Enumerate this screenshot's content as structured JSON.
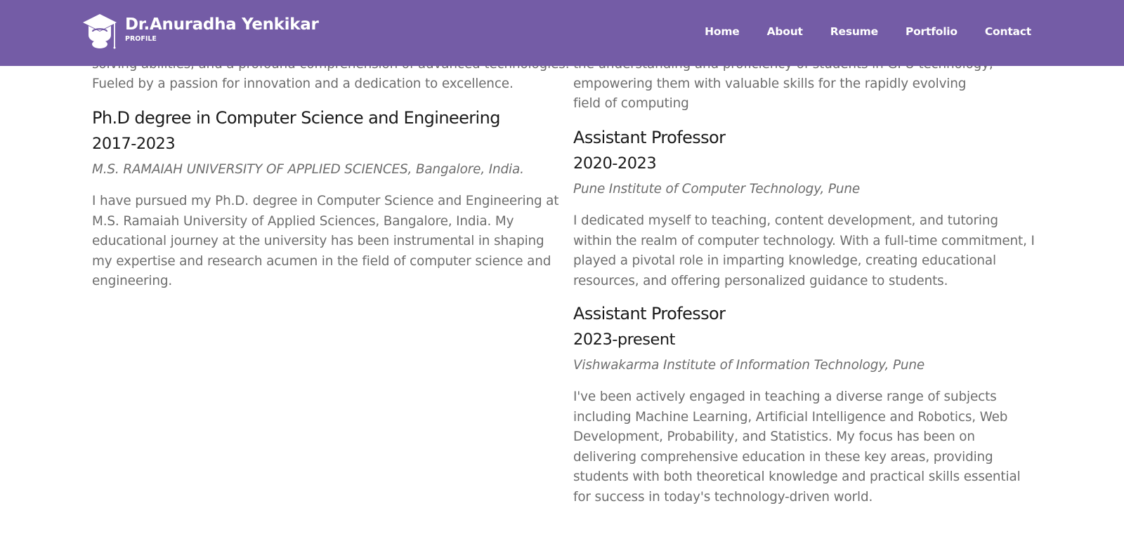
{
  "brand": {
    "name": "Dr.Anuradha Yenkikar",
    "subtitle": "PROFILE",
    "icon": "graduation-cap-icon"
  },
  "nav": {
    "items": [
      "Home",
      "About",
      "Resume",
      "Portfolio",
      "Contact"
    ]
  },
  "colors": {
    "navbar": "#745ca6",
    "text_muted": "#6d6d6d",
    "text_dark": "#1a1a1a"
  },
  "left": {
    "intro_lines": [
      "solving abilities, and a profound comprehension of advanced technologies.",
      "Fueled by a passion for innovation and a dedication to excellence."
    ],
    "entry": {
      "title": "Ph.D degree in Computer Science and Engineering",
      "years": "2017-2023",
      "institution": "M.S. RAMAIAH UNIVERSITY OF APPLIED SCIENCES, Bangalore, India.",
      "description": "I have pursued my Ph.D. degree in Computer Science and Engineering at M.S. Ramaiah University of Applied Sciences, Bangalore, India. My educational journey at the university has been instrumental in shaping my expertise and research acumen in the field of computer science and engineering."
    }
  },
  "right": {
    "intro_lines": [
      "the understanding and proficiency of students in GPU technology,",
      "empowering them with valuable skills for the rapidly evolving",
      "field of computing"
    ],
    "entries": [
      {
        "title": "Assistant Professor",
        "years": "2020-2023",
        "institution": "Pune Institute of Computer Technology, Pune",
        "description": "I dedicated myself to teaching, content development, and tutoring within the realm of computer technology. With a full-time commitment, I played a pivotal role in imparting knowledge, creating educational resources, and offering personalized guidance to students."
      },
      {
        "title": "Assistant Professor",
        "years": "2023-present",
        "institution": "Vishwakarma Institute of Information Technology, Pune",
        "description": "I've been actively engaged in teaching a diverse range of subjects including Machine Learning, Artificial Intelligence and Robotics, Web Development, Probability, and Statistics. My focus has been on delivering comprehensive education in these key areas, providing students with both theoretical knowledge and practical skills essential for success in today's technology-driven world."
      }
    ]
  }
}
